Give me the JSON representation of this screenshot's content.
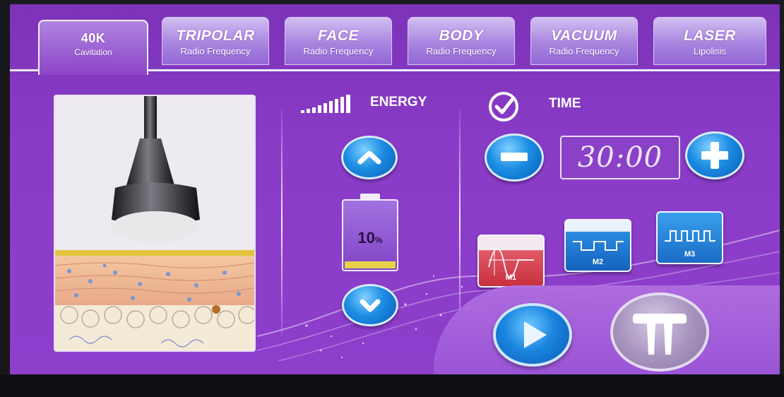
{
  "tabs": [
    {
      "title": "40K",
      "subtitle": "Cavitation",
      "active": true
    },
    {
      "title": "TRIPOLAR",
      "subtitle": "Radio Frequency",
      "active": false
    },
    {
      "title": "FACE",
      "subtitle": "Radio Frequency",
      "active": false
    },
    {
      "title": "BODY",
      "subtitle": "Radio Frequency",
      "active": false
    },
    {
      "title": "VACUUM",
      "subtitle": "Radio Frequency",
      "active": false
    },
    {
      "title": "LASER",
      "subtitle": "Lipolisis",
      "active": false
    }
  ],
  "energy": {
    "label": "ENERGY",
    "value": "10",
    "unit": "%",
    "level_fraction": 0.1
  },
  "time": {
    "label": "TIME",
    "value": "30:00"
  },
  "modes": [
    {
      "label": "M1",
      "selected": true
    },
    {
      "label": "M2",
      "selected": false
    },
    {
      "label": "M3",
      "selected": false
    }
  ],
  "colors": {
    "accent_purple": "#8a3cc8",
    "button_blue": "#1d8de3",
    "mode_selected_red": "#d8424f",
    "mode_blue": "#1f6fc8",
    "battery_fill_yellow": "#e8d24a"
  },
  "icons": {
    "energy": "signal-bars-icon",
    "time": "check-circle-icon",
    "energy_up": "chevron-up-icon",
    "energy_down": "chevron-down-icon",
    "time_minus": "minus-icon",
    "time_plus": "plus-icon",
    "start": "play-icon",
    "pause": "pause-icon"
  }
}
